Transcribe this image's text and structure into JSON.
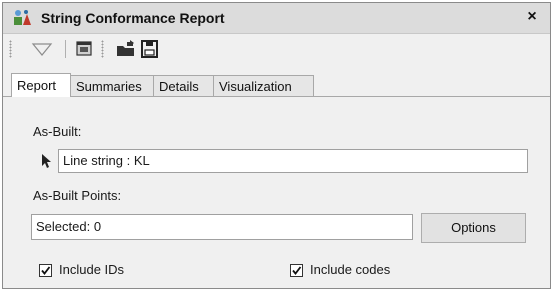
{
  "window": {
    "title": "String Conformance Report",
    "close_glyph": "×"
  },
  "toolbar": {
    "icons": [
      "filter-icon",
      "window-icon",
      "open-folder-icon",
      "save-icon"
    ]
  },
  "tabs": [
    {
      "label": "Report",
      "active": true
    },
    {
      "label": "Summaries",
      "active": false
    },
    {
      "label": "Details",
      "active": false
    },
    {
      "label": "Visualization",
      "active": false
    }
  ],
  "report": {
    "as_built_label": "As-Built:",
    "as_built_value": "Line string : KL",
    "as_built_points_label": "As-Built Points:",
    "selected_value": "Selected: 0",
    "options_button": "Options",
    "include_ids_label": "Include IDs",
    "include_ids_checked": true,
    "include_codes_label": "Include codes",
    "include_codes_checked": true
  },
  "colors": {
    "titlebar": "#dcdcdc",
    "panel": "#f0f0f0"
  }
}
